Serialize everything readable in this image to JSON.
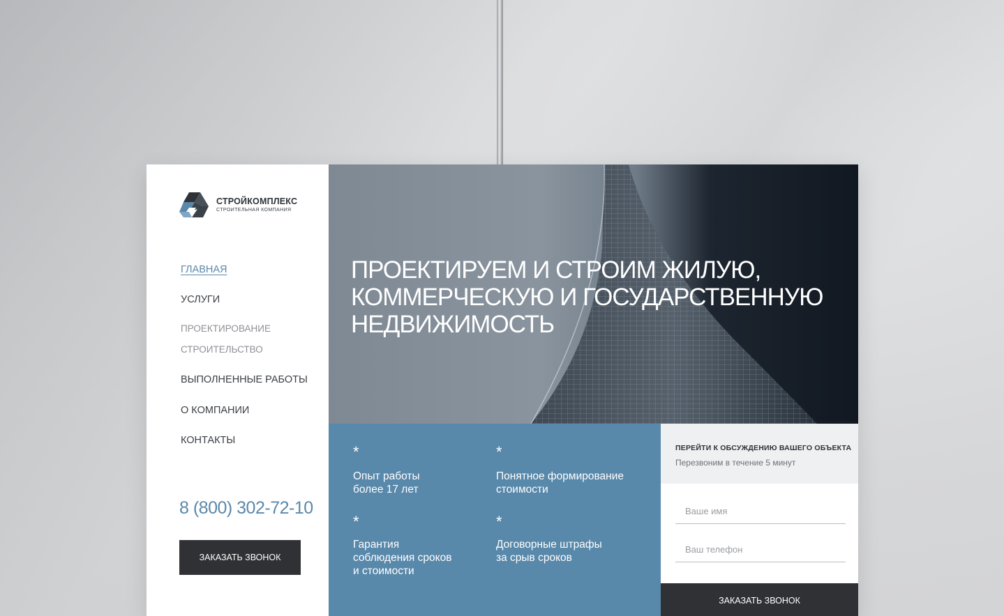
{
  "brand": {
    "name": "СТРОЙКОМПЛЕКС",
    "tagline": "СТРОИТЕЛЬНАЯ КОМПАНИЯ"
  },
  "nav": {
    "items": [
      {
        "label": "ГЛАВНАЯ",
        "active": true
      },
      {
        "label": "УСЛУГИ"
      },
      {
        "label": "ПРОЕКТИРОВАНИЕ",
        "sub": true
      },
      {
        "label": "СТРОИТЕЛЬСТВО",
        "sub": true
      },
      {
        "label": "ВЫПОЛНЕННЫЕ РАБОТЫ"
      },
      {
        "label": "О КОМПАНИИ"
      },
      {
        "label": "КОНТАКТЫ"
      }
    ]
  },
  "contact": {
    "phone": "8 (800) 302-72-10",
    "callback_label": "ЗАКАЗАТЬ ЗВОНОК"
  },
  "hero": {
    "line1": "ПРОЕКТИРУЕМ И СТРОИМ ЖИЛУЮ,",
    "line2": "КОММЕРЧЕСКУЮ И ГОСУДАРСТВЕННУЮ",
    "line3": "НЕДВИЖИМОСТЬ"
  },
  "features": [
    {
      "marker": "*",
      "line1": "Опыт работы",
      "line2": "более 17 лет",
      "line3": ""
    },
    {
      "marker": "*",
      "line1": "Понятное формирование",
      "line2": "стоимости",
      "line3": ""
    },
    {
      "marker": "*",
      "line1": "Гарантия",
      "line2": "соблюдения сроков",
      "line3": "и стоимости"
    },
    {
      "marker": "*",
      "line1": "Договорные штрафы",
      "line2": "за срыв сроков",
      "line3": ""
    }
  ],
  "form": {
    "title": "ПЕРЕЙТИ К ОБСУЖДЕНИЮ ВАШЕГО ОБЪЕКТА",
    "subtitle": "Перезвоним в течение 5 минут",
    "name_placeholder": "Ваше имя",
    "phone_placeholder": "Ваш телефон",
    "submit_label": "ЗАКАЗАТЬ ЗВОНОК"
  },
  "colors": {
    "accent": "#5888aa",
    "dark_button": "#2f3134",
    "text": "#3a3e44"
  }
}
